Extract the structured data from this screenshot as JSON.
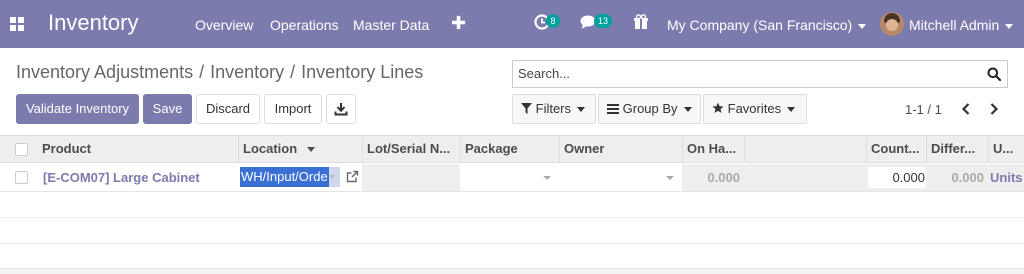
{
  "navbar": {
    "app_title": "Inventory",
    "menu": [
      "Overview",
      "Operations",
      "Master Data"
    ],
    "activity_count": "8",
    "message_count": "13",
    "company": "My Company (San Francisco)",
    "user": "Mitchell Admin"
  },
  "breadcrumb": [
    "Inventory Adjustments",
    "Inventory",
    "Inventory Lines"
  ],
  "search": {
    "placeholder": "Search..."
  },
  "buttons": {
    "validate": "Validate Inventory",
    "save": "Save",
    "discard": "Discard",
    "import": "Import"
  },
  "filters": {
    "filters": "Filters",
    "group_by": "Group By",
    "favorites": "Favorites"
  },
  "pager": {
    "value": "1-1 / 1"
  },
  "columns": [
    "Product",
    "Location",
    "Lot/Serial N...",
    "Package",
    "Owner",
    "On Ha...",
    "Count...",
    "Differ...",
    "U..."
  ],
  "row": {
    "product": "[E-COM07] Large Cabinet",
    "location": "WH/Input/Orde",
    "on_hand": "0.000",
    "counted": "0.000",
    "difference": "0.000",
    "uom": "Units"
  },
  "colors": {
    "brand": "#7c7bad",
    "badge": "#00a09d",
    "selection": "#3a6fd4"
  },
  "icons": [
    "apps-icon",
    "plus-icon",
    "activity-icon",
    "chat-icon",
    "gift-icon",
    "search-icon",
    "download-icon",
    "filter-icon",
    "group-by-icon",
    "star-icon",
    "chevron-left-icon",
    "chevron-right-icon",
    "external-link-icon",
    "sort-desc-icon"
  ]
}
